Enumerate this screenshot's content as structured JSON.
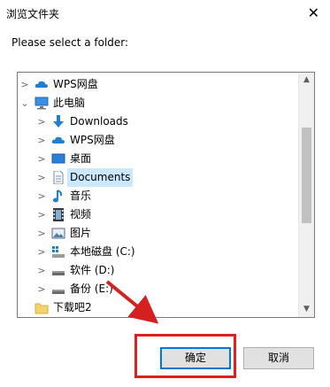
{
  "window": {
    "title": "浏览文件夹",
    "close_glyph": "✕"
  },
  "prompt": "Please select a folder:",
  "tree": {
    "items": [
      {
        "label": "WPS网盘",
        "icon": "cloud-icon",
        "expanded": false
      },
      {
        "label": "此电脑",
        "icon": "computer-icon",
        "expanded": true
      },
      {
        "label": "Downloads",
        "icon": "download-arrow-icon"
      },
      {
        "label": "WPS网盘",
        "icon": "cloud-icon"
      },
      {
        "label": "桌面",
        "icon": "desktop-icon"
      },
      {
        "label": "Documents",
        "icon": "document-icon",
        "selected": true
      },
      {
        "label": "音乐",
        "icon": "music-note-icon"
      },
      {
        "label": "视频",
        "icon": "film-icon"
      },
      {
        "label": "图片",
        "icon": "picture-icon"
      },
      {
        "label": "本地磁盘 (C:)",
        "icon": "system-drive-icon"
      },
      {
        "label": "软件 (D:)",
        "icon": "drive-icon"
      },
      {
        "label": "备份 (E:)",
        "icon": "drive-icon"
      },
      {
        "label": "下载吧2",
        "icon": "folder-icon"
      }
    ]
  },
  "buttons": {
    "ok": "确定",
    "cancel": "取消"
  },
  "colors": {
    "selection": "#cce8ff",
    "focus_border": "#0078d7",
    "annotation": "#e02020"
  }
}
